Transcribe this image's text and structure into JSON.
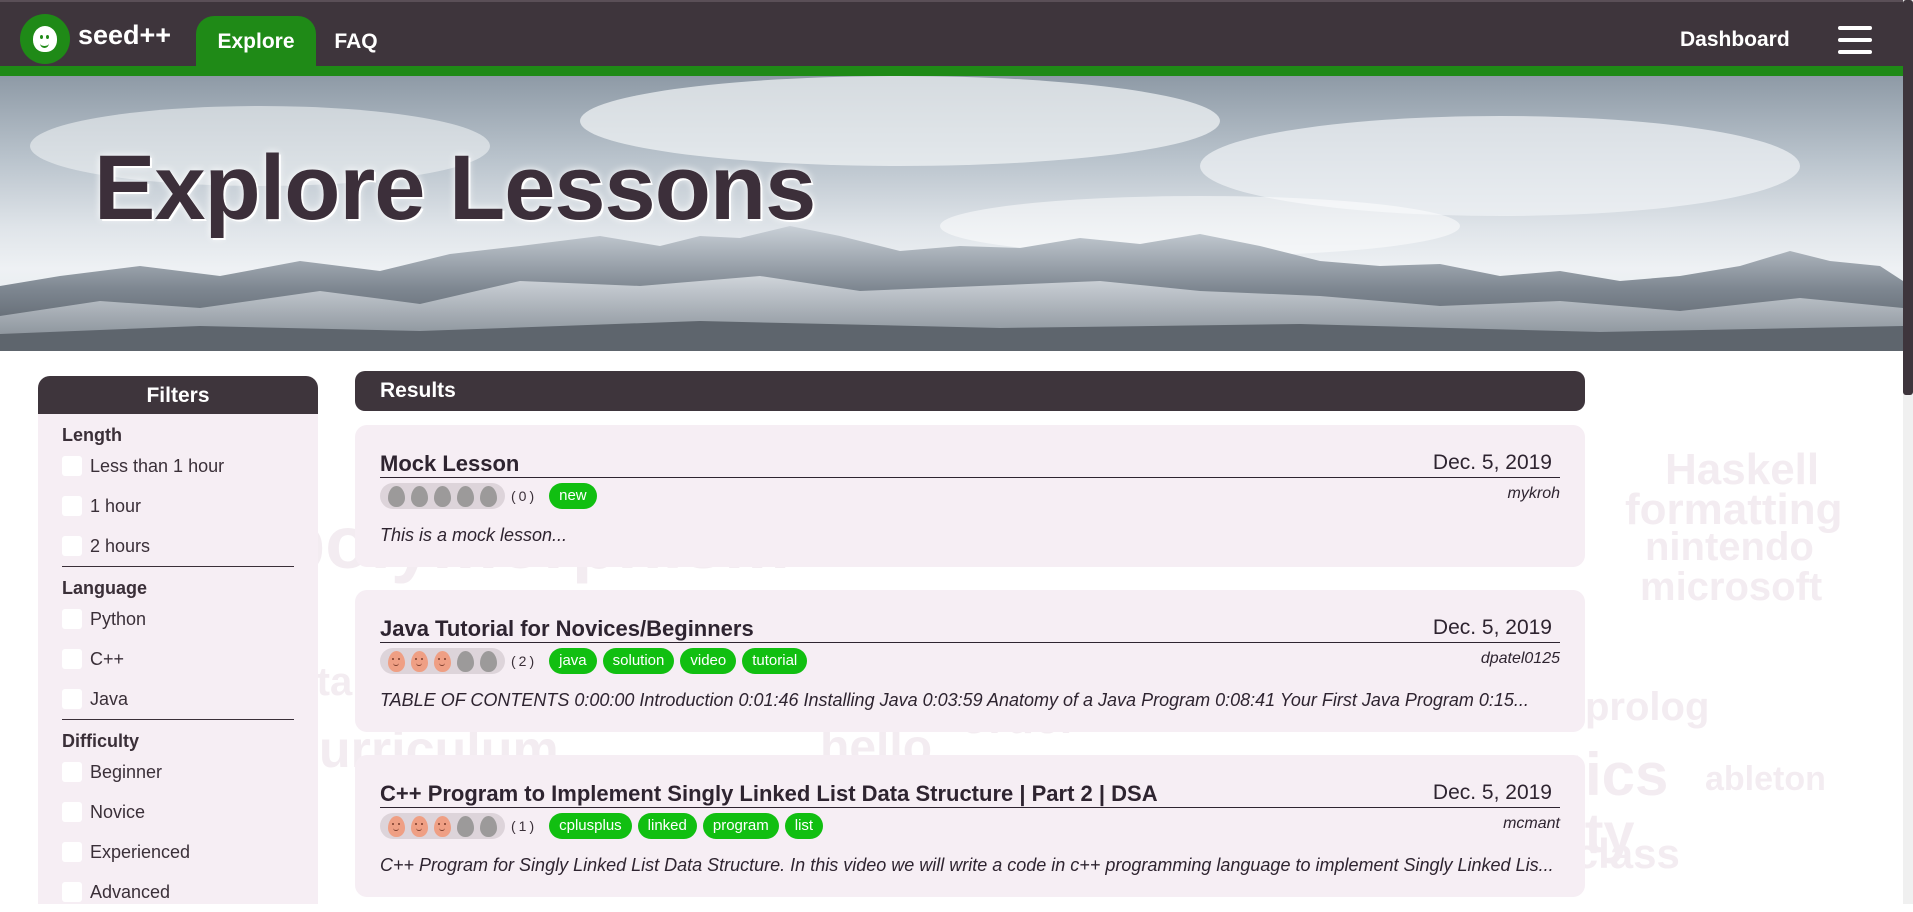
{
  "nav": {
    "brand": "seed++",
    "tabs": [
      {
        "label": "Explore",
        "active": true
      },
      {
        "label": "FAQ",
        "active": false
      }
    ],
    "dashboard": "Dashboard",
    "menu_icon": "hamburger-icon"
  },
  "hero": {
    "title": "Explore Lessons"
  },
  "filters": {
    "title": "Filters",
    "groups": [
      {
        "title": "Length",
        "options": [
          "Less than 1 hour",
          "1 hour",
          "2 hours"
        ]
      },
      {
        "title": "Language",
        "options": [
          "Python",
          "C++",
          "Java"
        ]
      },
      {
        "title": "Difficulty",
        "options": [
          "Beginner",
          "Novice",
          "Experienced",
          "Advanced"
        ]
      }
    ]
  },
  "results": {
    "title": "Results",
    "lessons": [
      {
        "title": "Mock Lesson",
        "date": "Dec. 5, 2019",
        "rating": 0,
        "rating_max": 5,
        "count": "(0)",
        "tags": [
          "new"
        ],
        "author": "mykroh",
        "description": "This is a mock lesson..."
      },
      {
        "title": "Java Tutorial for Novices/Beginners",
        "date": "Dec. 5, 2019",
        "rating": 3,
        "rating_max": 5,
        "count": "(2)",
        "tags": [
          "java",
          "solution",
          "video",
          "tutorial"
        ],
        "author": "dpatel0125",
        "description": "TABLE OF CONTENTS 0:00:00 Introduction 0:01:46 Installing Java 0:03:59 Anatomy of a Java Program 0:08:41 Your First Java Program 0:15..."
      },
      {
        "title": "C++ Program to Implement Singly Linked List Data Structure | Part 2 | DSA",
        "date": "Dec. 5, 2019",
        "rating": 3,
        "rating_max": 5,
        "count": "(1)",
        "tags": [
          "cplusplus",
          "linked",
          "program",
          "list"
        ],
        "author": "mcmant",
        "description": "C++ Program for Singly Linked List Data Structure. In this video we will write a code in c++ programming language to implement Singly Linked Lis..."
      }
    ]
  },
  "background_words": [
    "Haskell",
    "formatting",
    "nintendo",
    "microsoft",
    "prolog",
    "tics",
    "nity",
    "ableton",
    "curriculum",
    "hello",
    "order",
    "polymorphism",
    "data",
    "keysubclass"
  ],
  "colors": {
    "nav_bg": "#3e353c",
    "brand_green": "#1f8a17",
    "tag_green": "#11bf11",
    "card_bg": "#f6eef4",
    "egg_on": "#ef9f84",
    "egg_off": "#9c9a9a"
  }
}
